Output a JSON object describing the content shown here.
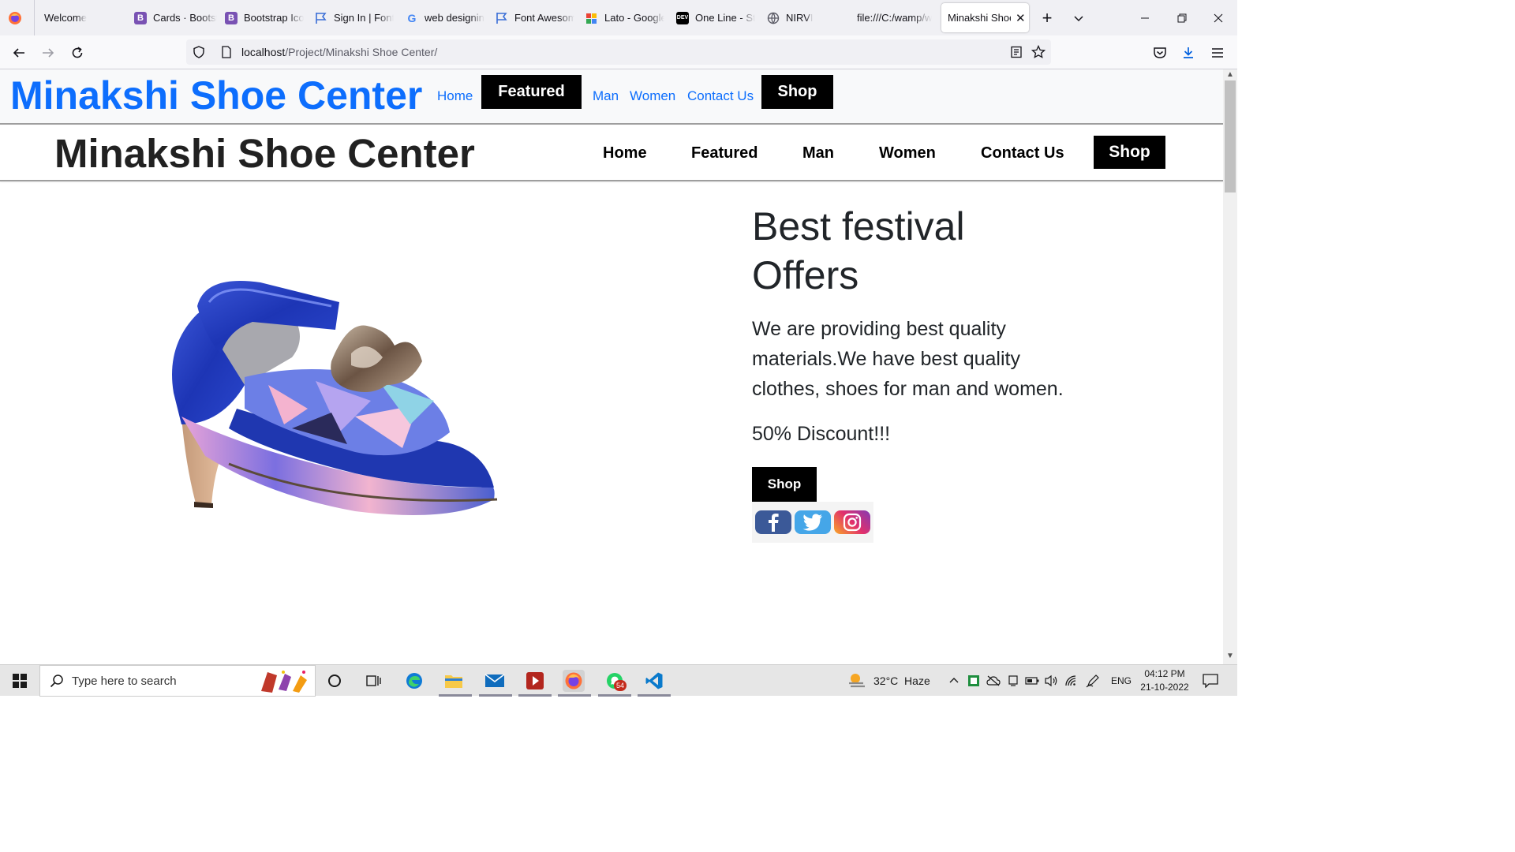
{
  "browser": {
    "tabs": [
      {
        "title": "Welcome",
        "icon": "firefox-welcome-icon"
      },
      {
        "title": "Cards · Bootstrap",
        "icon": "bootstrap-icon"
      },
      {
        "title": "Bootstrap Icons",
        "icon": "bootstrap-icon"
      },
      {
        "title": "Sign In | Font Awesome",
        "icon": "flag-icon"
      },
      {
        "title": "web designing",
        "icon": "google-icon"
      },
      {
        "title": "Font Awesome",
        "icon": "flag-icon"
      },
      {
        "title": "Lato - Google Fonts",
        "icon": "google-fonts-icon"
      },
      {
        "title": "One Line - St",
        "icon": "dev-icon"
      },
      {
        "title": "NIRVI",
        "icon": "globe-icon"
      },
      {
        "title": "file:///C:/wamp/w",
        "icon": "none"
      },
      {
        "title": "Minakshi Shoe",
        "icon": "none",
        "active": true
      }
    ],
    "new_tab": "+",
    "tab_list": "⌄",
    "url_host": "localhost",
    "url_path": "/Project/Minakshi Shoe Center/"
  },
  "page": {
    "header1": {
      "brand": "Minakshi Shoe Center",
      "links": [
        "Home",
        "Featured",
        "Man",
        "Women",
        "Contact Us",
        "Shop"
      ]
    },
    "header2": {
      "brand": "Minakshi Shoe Center",
      "links": [
        "Home",
        "Featured",
        "Man",
        "Women",
        "Contact Us",
        "Shop"
      ]
    },
    "hero": {
      "title": "Best festival Offers",
      "description": "We are providing best quality materials.We have best quality clothes, shoes for man and women.",
      "discount": "50% Discount!!!",
      "button": "Shop",
      "social": [
        "facebook-icon",
        "twitter-icon",
        "instagram-icon"
      ]
    },
    "colors": {
      "brand_blue": "#0d6efd",
      "black": "#000000"
    }
  },
  "taskbar": {
    "search_placeholder": "Type here to search",
    "weather": "32°C  Haze",
    "language": "ENG",
    "time": "04:12 PM",
    "date": "21-10-2022",
    "whatsapp_badge": "54"
  }
}
